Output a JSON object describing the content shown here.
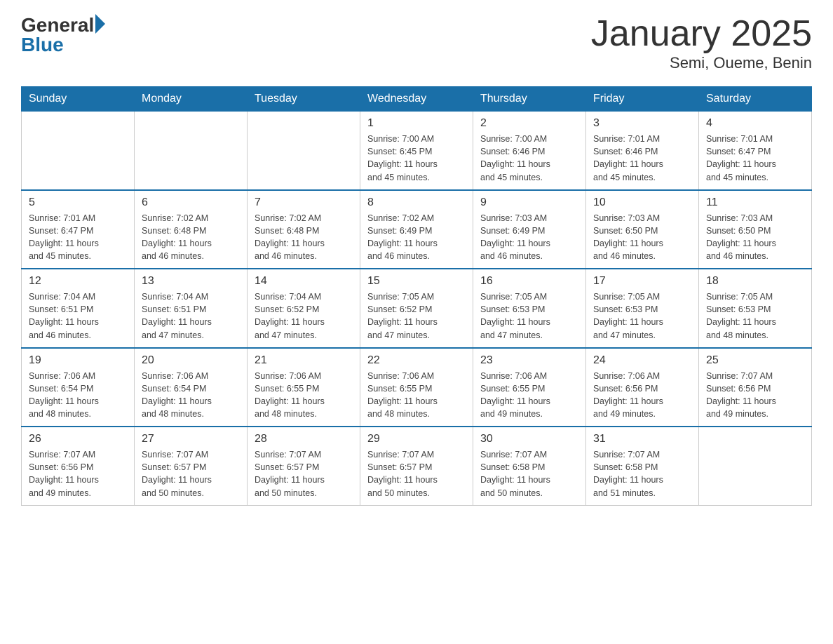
{
  "header": {
    "logo_general": "General",
    "logo_blue": "Blue",
    "title": "January 2025",
    "subtitle": "Semi, Oueme, Benin"
  },
  "days_of_week": [
    "Sunday",
    "Monday",
    "Tuesday",
    "Wednesday",
    "Thursday",
    "Friday",
    "Saturday"
  ],
  "weeks": [
    [
      {
        "day": "",
        "info": ""
      },
      {
        "day": "",
        "info": ""
      },
      {
        "day": "",
        "info": ""
      },
      {
        "day": "1",
        "info": "Sunrise: 7:00 AM\nSunset: 6:45 PM\nDaylight: 11 hours\nand 45 minutes."
      },
      {
        "day": "2",
        "info": "Sunrise: 7:00 AM\nSunset: 6:46 PM\nDaylight: 11 hours\nand 45 minutes."
      },
      {
        "day": "3",
        "info": "Sunrise: 7:01 AM\nSunset: 6:46 PM\nDaylight: 11 hours\nand 45 minutes."
      },
      {
        "day": "4",
        "info": "Sunrise: 7:01 AM\nSunset: 6:47 PM\nDaylight: 11 hours\nand 45 minutes."
      }
    ],
    [
      {
        "day": "5",
        "info": "Sunrise: 7:01 AM\nSunset: 6:47 PM\nDaylight: 11 hours\nand 45 minutes."
      },
      {
        "day": "6",
        "info": "Sunrise: 7:02 AM\nSunset: 6:48 PM\nDaylight: 11 hours\nand 46 minutes."
      },
      {
        "day": "7",
        "info": "Sunrise: 7:02 AM\nSunset: 6:48 PM\nDaylight: 11 hours\nand 46 minutes."
      },
      {
        "day": "8",
        "info": "Sunrise: 7:02 AM\nSunset: 6:49 PM\nDaylight: 11 hours\nand 46 minutes."
      },
      {
        "day": "9",
        "info": "Sunrise: 7:03 AM\nSunset: 6:49 PM\nDaylight: 11 hours\nand 46 minutes."
      },
      {
        "day": "10",
        "info": "Sunrise: 7:03 AM\nSunset: 6:50 PM\nDaylight: 11 hours\nand 46 minutes."
      },
      {
        "day": "11",
        "info": "Sunrise: 7:03 AM\nSunset: 6:50 PM\nDaylight: 11 hours\nand 46 minutes."
      }
    ],
    [
      {
        "day": "12",
        "info": "Sunrise: 7:04 AM\nSunset: 6:51 PM\nDaylight: 11 hours\nand 46 minutes."
      },
      {
        "day": "13",
        "info": "Sunrise: 7:04 AM\nSunset: 6:51 PM\nDaylight: 11 hours\nand 47 minutes."
      },
      {
        "day": "14",
        "info": "Sunrise: 7:04 AM\nSunset: 6:52 PM\nDaylight: 11 hours\nand 47 minutes."
      },
      {
        "day": "15",
        "info": "Sunrise: 7:05 AM\nSunset: 6:52 PM\nDaylight: 11 hours\nand 47 minutes."
      },
      {
        "day": "16",
        "info": "Sunrise: 7:05 AM\nSunset: 6:53 PM\nDaylight: 11 hours\nand 47 minutes."
      },
      {
        "day": "17",
        "info": "Sunrise: 7:05 AM\nSunset: 6:53 PM\nDaylight: 11 hours\nand 47 minutes."
      },
      {
        "day": "18",
        "info": "Sunrise: 7:05 AM\nSunset: 6:53 PM\nDaylight: 11 hours\nand 48 minutes."
      }
    ],
    [
      {
        "day": "19",
        "info": "Sunrise: 7:06 AM\nSunset: 6:54 PM\nDaylight: 11 hours\nand 48 minutes."
      },
      {
        "day": "20",
        "info": "Sunrise: 7:06 AM\nSunset: 6:54 PM\nDaylight: 11 hours\nand 48 minutes."
      },
      {
        "day": "21",
        "info": "Sunrise: 7:06 AM\nSunset: 6:55 PM\nDaylight: 11 hours\nand 48 minutes."
      },
      {
        "day": "22",
        "info": "Sunrise: 7:06 AM\nSunset: 6:55 PM\nDaylight: 11 hours\nand 48 minutes."
      },
      {
        "day": "23",
        "info": "Sunrise: 7:06 AM\nSunset: 6:55 PM\nDaylight: 11 hours\nand 49 minutes."
      },
      {
        "day": "24",
        "info": "Sunrise: 7:06 AM\nSunset: 6:56 PM\nDaylight: 11 hours\nand 49 minutes."
      },
      {
        "day": "25",
        "info": "Sunrise: 7:07 AM\nSunset: 6:56 PM\nDaylight: 11 hours\nand 49 minutes."
      }
    ],
    [
      {
        "day": "26",
        "info": "Sunrise: 7:07 AM\nSunset: 6:56 PM\nDaylight: 11 hours\nand 49 minutes."
      },
      {
        "day": "27",
        "info": "Sunrise: 7:07 AM\nSunset: 6:57 PM\nDaylight: 11 hours\nand 50 minutes."
      },
      {
        "day": "28",
        "info": "Sunrise: 7:07 AM\nSunset: 6:57 PM\nDaylight: 11 hours\nand 50 minutes."
      },
      {
        "day": "29",
        "info": "Sunrise: 7:07 AM\nSunset: 6:57 PM\nDaylight: 11 hours\nand 50 minutes."
      },
      {
        "day": "30",
        "info": "Sunrise: 7:07 AM\nSunset: 6:58 PM\nDaylight: 11 hours\nand 50 minutes."
      },
      {
        "day": "31",
        "info": "Sunrise: 7:07 AM\nSunset: 6:58 PM\nDaylight: 11 hours\nand 51 minutes."
      },
      {
        "day": "",
        "info": ""
      }
    ]
  ]
}
